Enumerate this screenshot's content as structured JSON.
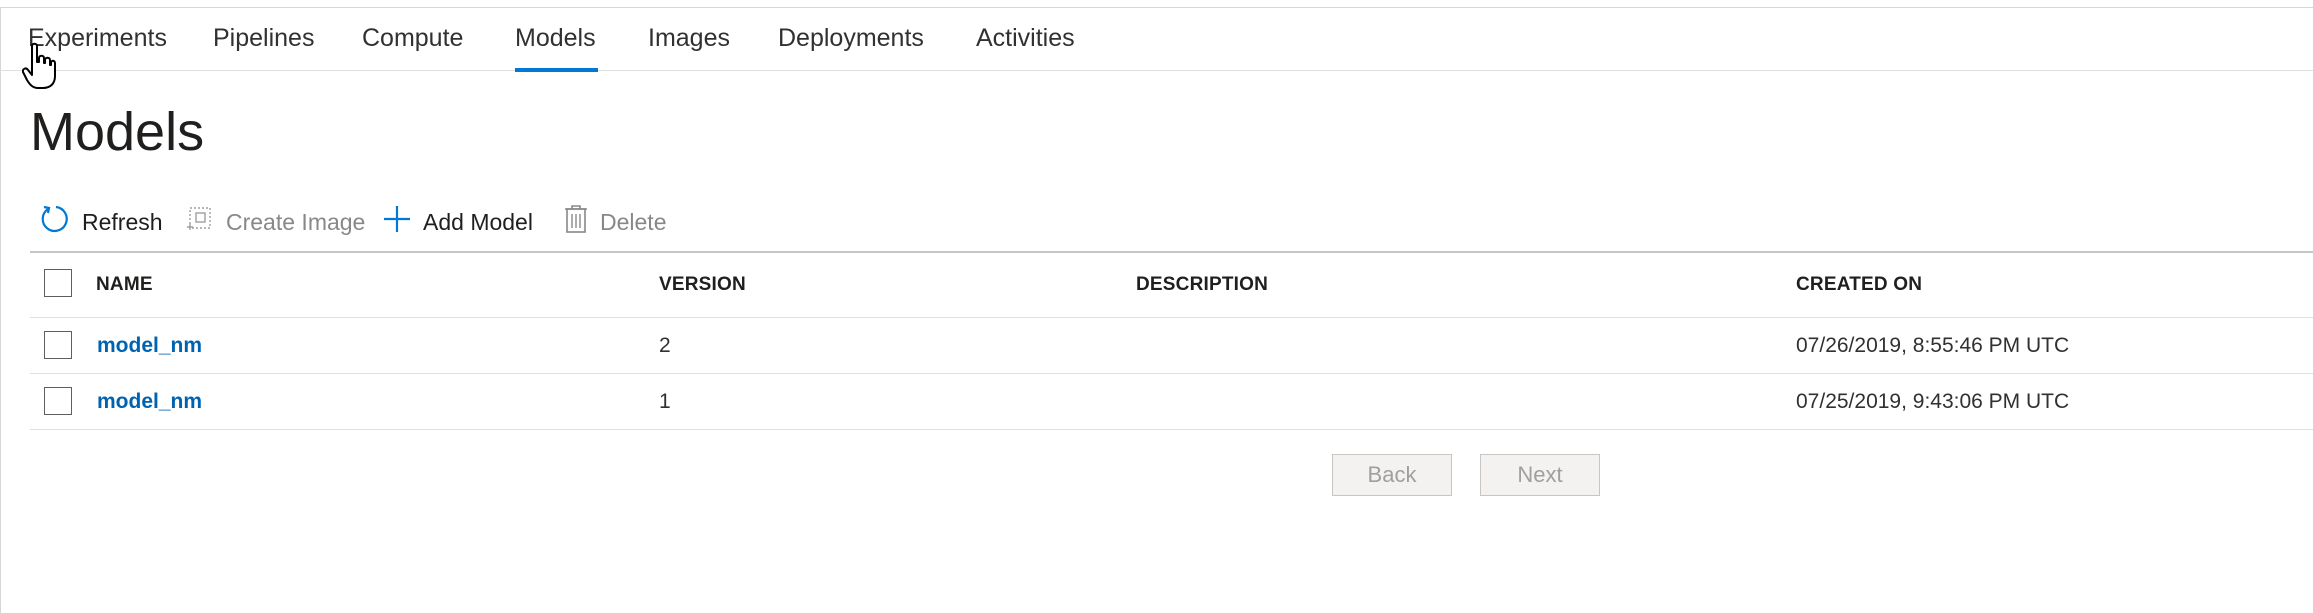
{
  "tabs": [
    {
      "label": "Experiments"
    },
    {
      "label": "Pipelines"
    },
    {
      "label": "Compute"
    },
    {
      "label": "Models"
    },
    {
      "label": "Images"
    },
    {
      "label": "Deployments"
    },
    {
      "label": "Activities"
    }
  ],
  "active_tab": "Models",
  "page_title": "Models",
  "toolbar": {
    "refresh": "Refresh",
    "create_image": "Create Image",
    "add_model": "Add Model",
    "delete": "Delete"
  },
  "table": {
    "columns": [
      "NAME",
      "VERSION",
      "DESCRIPTION",
      "CREATED ON"
    ],
    "rows": [
      {
        "name": "model_nm",
        "version": "2",
        "description": "",
        "created_on": "07/26/2019, 8:55:46 PM UTC"
      },
      {
        "name": "model_nm",
        "version": "1",
        "description": "",
        "created_on": "07/25/2019, 9:43:06 PM UTC"
      }
    ]
  },
  "pager": {
    "back": "Back",
    "next": "Next"
  },
  "colors": {
    "accent": "#0078d4",
    "link": "#0063b1",
    "disabled": "#8a8886"
  }
}
